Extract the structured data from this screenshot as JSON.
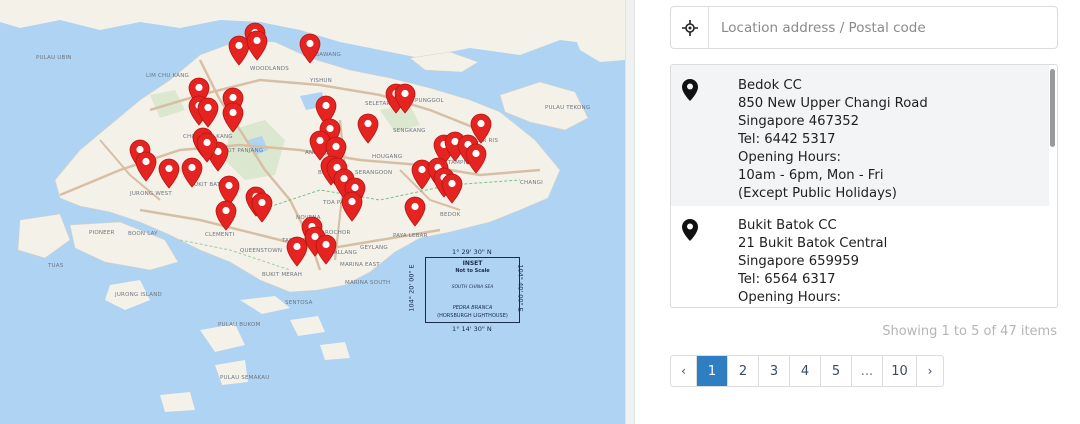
{
  "map": {
    "labels": [
      "PULAU UBIN",
      "SEMBAWANG",
      "WOODLANDS",
      "LIM CHU KANG",
      "SELETAR",
      "SENGKANG",
      "PUNGGOL",
      "YISHUN",
      "HOUGANG",
      "CHOA CHU KANG",
      "BUKIT PANJANG",
      "TAMPINES",
      "PASIR RIS",
      "BEDOK",
      "JURONG WEST",
      "BOON LAY",
      "PIONEER",
      "TUAS",
      "JURONG ISLAND",
      "QUEENSTOWN",
      "TANGLIN",
      "BUKIT MERAH",
      "MARINA EAST",
      "MARINA SOUTH",
      "SENTOSA",
      "CHANGI",
      "PAYA LEBAR",
      "TOA PAYOH",
      "BISHAN",
      "GEYLANG",
      "KALLANG",
      "SERANGOON",
      "ANG MO KIO",
      "BUKIT BATOK",
      "CLEMENTI",
      "PULAU BUKOM",
      "PULAU SEMAKAU",
      "PULAU TEKONG",
      "ROCHOR",
      "NOVENA"
    ],
    "inset": {
      "title": "INSET",
      "subtitle": "Not to Scale",
      "sea": "SOUTH CHINA SEA",
      "place": "PEDRA BRANCA",
      "place_sub": "(HORSBURGH LIGHTHOUSE)",
      "coord_top": "1° 29' 30\" N",
      "coord_bottom": "1° 14' 30\" N",
      "coord_left": "104° 20' 00\" E",
      "coord_right": "104° 40' 00\" E"
    },
    "marker_icon": "map-marker-icon"
  },
  "search": {
    "placeholder": "Location address / Postal code",
    "value": "",
    "icon": "crosshair-locate-icon"
  },
  "results": [
    {
      "lines": [
        "Bedok CC",
        "850 New Upper Changi Road",
        "Singapore 467352",
        "Tel: 6442 5317",
        "Opening Hours:",
        "10am - 6pm, Mon - Fri",
        "(Except Public Holidays)"
      ]
    },
    {
      "lines": [
        "Bukit Batok CC",
        "21 Bukit Batok Central",
        "Singapore 659959",
        "Tel: 6564 6317",
        "Opening Hours:"
      ]
    }
  ],
  "summary": "Showing 1 to 5 of 47 items",
  "pagination": {
    "prev": "‹",
    "next": "›",
    "pages": [
      "1",
      "2",
      "3",
      "4",
      "5",
      "...",
      "10"
    ],
    "active": "1"
  }
}
